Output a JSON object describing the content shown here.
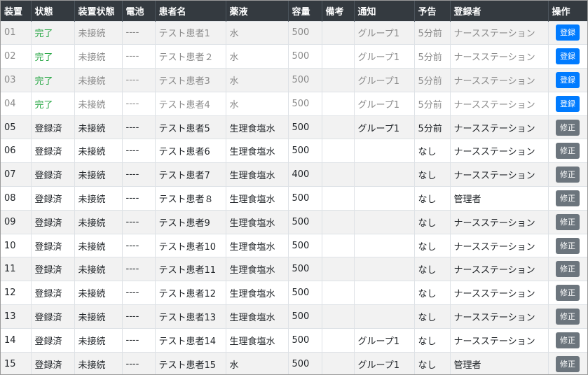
{
  "columns": [
    "装置",
    "状態",
    "装置状態",
    "電池",
    "患者名",
    "薬液",
    "容量",
    "備考",
    "通知",
    "予告",
    "登録者",
    "操作"
  ],
  "rows": [
    {
      "device": "01",
      "status": "完了",
      "device_status": "未接続",
      "battery": "----",
      "patient": "テスト患者1",
      "drug": "水",
      "volume": "500",
      "note": "",
      "notify": "グループ1",
      "notice": "5分前",
      "registrant": "ナースステーション",
      "action": "登録",
      "action_type": "primary"
    },
    {
      "device": "02",
      "status": "完了",
      "device_status": "未接続",
      "battery": "----",
      "patient": "テスト患者２",
      "drug": "水",
      "volume": "500",
      "note": "",
      "notify": "グループ1",
      "notice": "5分前",
      "registrant": "ナースステーション",
      "action": "登録",
      "action_type": "primary"
    },
    {
      "device": "03",
      "status": "完了",
      "device_status": "未接続",
      "battery": "----",
      "patient": "テスト患者3",
      "drug": "水",
      "volume": "500",
      "note": "",
      "notify": "グループ1",
      "notice": "5分前",
      "registrant": "ナースステーション",
      "action": "登録",
      "action_type": "primary"
    },
    {
      "device": "04",
      "status": "完了",
      "device_status": "未接続",
      "battery": "----",
      "patient": "テスト患者4",
      "drug": "水",
      "volume": "500",
      "note": "",
      "notify": "グループ1",
      "notice": "5分前",
      "registrant": "ナースステーション",
      "action": "登録",
      "action_type": "primary"
    },
    {
      "device": "05",
      "status": "登録済",
      "device_status": "未接続",
      "battery": "----",
      "patient": "テスト患者5",
      "drug": "生理食塩水",
      "volume": "500",
      "note": "",
      "notify": "グループ1",
      "notice": "5分前",
      "registrant": "ナースステーション",
      "action": "修正",
      "action_type": "secondary"
    },
    {
      "device": "06",
      "status": "登録済",
      "device_status": "未接続",
      "battery": "----",
      "patient": "テスト患者6",
      "drug": "生理食塩水",
      "volume": "500",
      "note": "",
      "notify": "",
      "notice": "なし",
      "registrant": "ナースステーション",
      "action": "修正",
      "action_type": "secondary"
    },
    {
      "device": "07",
      "status": "登録済",
      "device_status": "未接続",
      "battery": "----",
      "patient": "テスト患者7",
      "drug": "生理食塩水",
      "volume": "400",
      "note": "",
      "notify": "",
      "notice": "なし",
      "registrant": "ナースステーション",
      "action": "修正",
      "action_type": "secondary"
    },
    {
      "device": "08",
      "status": "登録済",
      "device_status": "未接続",
      "battery": "----",
      "patient": "テスト患者８",
      "drug": "生理食塩水",
      "volume": "500",
      "note": "",
      "notify": "",
      "notice": "なし",
      "registrant": "管理者",
      "action": "修正",
      "action_type": "secondary"
    },
    {
      "device": "09",
      "status": "登録済",
      "device_status": "未接続",
      "battery": "----",
      "patient": "テスト患者9",
      "drug": "生理食塩水",
      "volume": "500",
      "note": "",
      "notify": "",
      "notice": "なし",
      "registrant": "ナースステーション",
      "action": "修正",
      "action_type": "secondary"
    },
    {
      "device": "10",
      "status": "登録済",
      "device_status": "未接続",
      "battery": "----",
      "patient": "テスト患者10",
      "drug": "生理食塩水",
      "volume": "500",
      "note": "",
      "notify": "",
      "notice": "なし",
      "registrant": "ナースステーション",
      "action": "修正",
      "action_type": "secondary"
    },
    {
      "device": "11",
      "status": "登録済",
      "device_status": "未接続",
      "battery": "----",
      "patient": "テスト患者11",
      "drug": "生理食塩水",
      "volume": "500",
      "note": "",
      "notify": "",
      "notice": "なし",
      "registrant": "ナースステーション",
      "action": "修正",
      "action_type": "secondary"
    },
    {
      "device": "12",
      "status": "登録済",
      "device_status": "未接続",
      "battery": "----",
      "patient": "テスト患者12",
      "drug": "生理食塩水",
      "volume": "500",
      "note": "",
      "notify": "",
      "notice": "なし",
      "registrant": "ナースステーション",
      "action": "修正",
      "action_type": "secondary"
    },
    {
      "device": "13",
      "status": "登録済",
      "device_status": "未接続",
      "battery": "----",
      "patient": "テスト患者13",
      "drug": "生理食塩水",
      "volume": "500",
      "note": "",
      "notify": "",
      "notice": "なし",
      "registrant": "ナースステーション",
      "action": "修正",
      "action_type": "secondary"
    },
    {
      "device": "14",
      "status": "登録済",
      "device_status": "未接続",
      "battery": "----",
      "patient": "テスト患者14",
      "drug": "生理食塩水",
      "volume": "500",
      "note": "",
      "notify": "グループ1",
      "notice": "なし",
      "registrant": "ナースステーション",
      "action": "修正",
      "action_type": "secondary"
    },
    {
      "device": "15",
      "status": "登録済",
      "device_status": "未接続",
      "battery": "----",
      "patient": "テスト患者15",
      "drug": "水",
      "volume": "500",
      "note": "",
      "notify": "グループ1",
      "notice": "なし",
      "registrant": "管理者",
      "action": "修正",
      "action_type": "secondary"
    }
  ],
  "colors": {
    "header_bg": "#343a40",
    "completed_text": "#28a745",
    "primary_button": "#007bff",
    "secondary_button": "#6c757d"
  }
}
